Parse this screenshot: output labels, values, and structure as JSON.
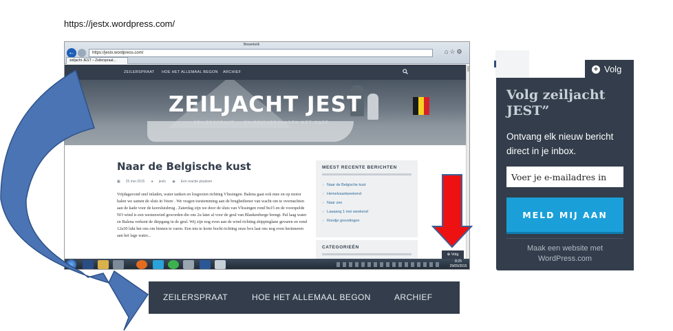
{
  "caption": {
    "url": "https://jestx.wordpress.com/"
  },
  "browser": {
    "address": "https://jestx.wordpress.com/",
    "tab_title": "zeiljacht JEST – Zeilerspraat...",
    "window_title_hint": "Bewerkelk"
  },
  "site": {
    "nav": [
      "ZEILERSPRAAT",
      "HOE HET ALLEMAAL BEGON",
      "ARCHIEF"
    ],
    "title": "ZEILJACHT JEST",
    "tagline": "ZEILERSPRAAT ... EN REISVERSLAGEN MET ONZE ...",
    "post": {
      "title": "Naar de Belgische kust",
      "date": "25 mei 2015",
      "author": "jestx",
      "comment_link": "Een reactie plaatsen",
      "body": "Vrijdagavond snel inladen, water tanken en losgooien richting Vlissingen. Balena gaat ook mee en op motor halen we samen de sluis in Veere . We vragen toestemming aan de brugbediener van wacht om te overnachten aan de kade voor de keersluisbrug . Zaterdag zijn we door de sluis van Vlissingen rond 9u15 en de voorspelde NO wind is een westenwind geworden die ons 2u later al voor de geul van Blankenberge brengt. Pal laag water en Balena verkent de diepgang in de geul. Wij zijn nog even aan de wind richting shippinglane gevaren en rond 12u30 lukt het ons om binnen te varen. Een iets te korte bocht richting onze box laat ons nog even herinneren aan het lage water..."
    },
    "recent_widget": {
      "title": "MEEST RECENTE BERICHTEN",
      "items": [
        "Naar de Belgische kust",
        "Hemelvaartweekend",
        "Naar zee",
        "Laaaang 1 mei weekend",
        "Rondje grevelingen"
      ]
    },
    "categories_widget": {
      "title": "CATEGORIEËN"
    },
    "mini_follow_label": "Volg"
  },
  "taskbar": {
    "time": "8:25",
    "date": "29/05/2015"
  },
  "big_nav": [
    "ZEILERSPRAAT",
    "HOE HET ALLEMAAL BEGON",
    "ARCHIEF"
  ],
  "follow": {
    "tab_label": "Volg",
    "title": "Volg zeiljacht JEST”",
    "description": "Ontvang elk nieuw bericht direct in je inbox.",
    "email_placeholder": "Voer je e-mailadres in",
    "button_label": "Meld mij aan",
    "footer_link": "Maak een website met WordPress.com"
  },
  "colors": {
    "nav_bg": "#333d4b",
    "button_blue": "#1a9fd9",
    "arrow_blue": "#4a74b4",
    "arrow_red": "#ee1111"
  },
  "icons": [
    "back-icon",
    "search-icon",
    "plus-icon",
    "calendar-icon",
    "user-icon",
    "comment-icon"
  ]
}
